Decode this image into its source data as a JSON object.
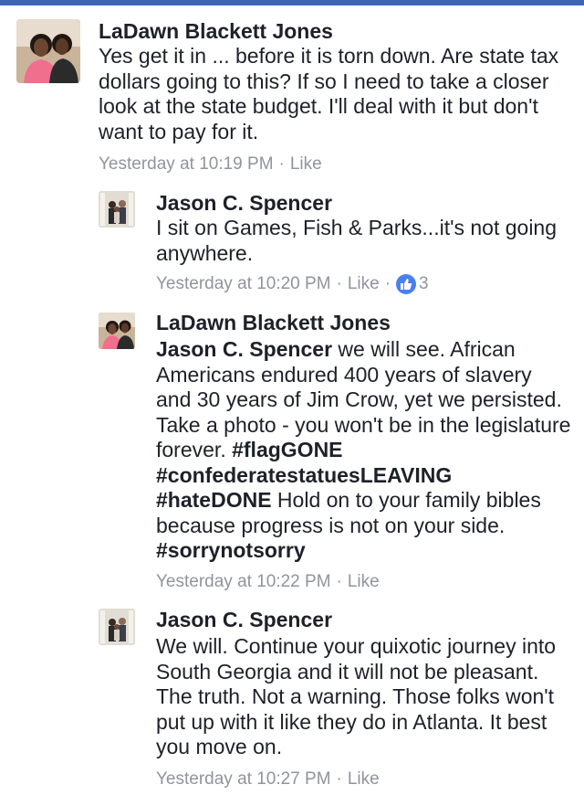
{
  "comments": [
    {
      "author": "LaDawn Blackett Jones",
      "text": "Yes get it in ... before it is torn down. Are state tax dollars going to this? If so I need to take a closer look at the state budget. I'll deal with it but don't want to pay for it.",
      "timestamp": "Yesterday at 10:19 PM",
      "like_label": "Like"
    },
    {
      "author": "Jason C. Spencer",
      "text": "I sit on Games, Fish & Parks...it's not going anywhere.",
      "timestamp": "Yesterday at 10:20 PM",
      "like_label": "Like",
      "reaction_count": "3",
      "reaction_icon": "thumbs-up-icon"
    },
    {
      "author": "LaDawn Blackett Jones",
      "mention": "Jason C. Spencer",
      "text_1": " we will see. African Americans endured 400 years of slavery and 30 years of Jim Crow, yet we persisted. Take a photo - you won't be in the legislature forever. ",
      "tag_1": "#flagGONE",
      "tag_2": "#confederatestatuesLEAVING",
      "tag_3": "#hateDONE",
      "text_2": " Hold on to your family bibles because progress is not on your side. ",
      "tag_4": "#sorrynotsorry",
      "timestamp": "Yesterday at 10:22 PM",
      "like_label": "Like"
    },
    {
      "author": "Jason C. Spencer",
      "text": "We will. Continue your quixotic journey into South Georgia and it will not be pleasant. The truth. Not a warning. Those folks won't put up with it like they do in Atlanta. It best you move on.",
      "timestamp": "Yesterday at 10:27 PM",
      "like_label": "Like"
    }
  ],
  "meta_separator": "·",
  "colors": {
    "accent": "#4267b2",
    "meta_text": "#90949c",
    "like_badge": "#4a7ff0"
  }
}
